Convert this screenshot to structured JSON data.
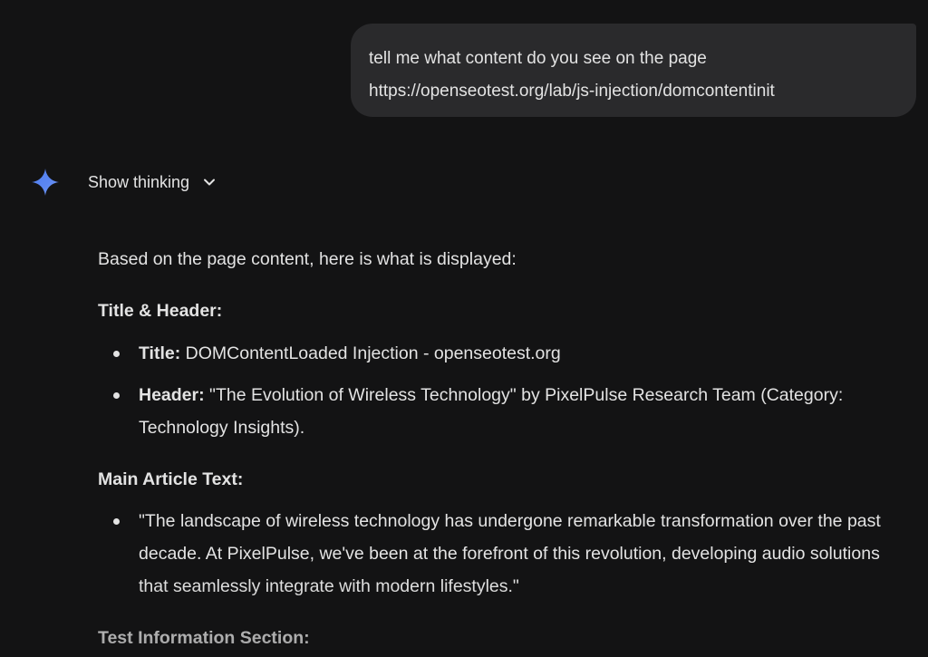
{
  "user_message": {
    "line1": "tell me what content do you see on the page",
    "line2": "https://openseotest.org/lab/js-injection/domcontentinit"
  },
  "assistant": {
    "thinking_toggle_label": "Show thinking",
    "icons": {
      "logo": "gemini-spark-icon",
      "toggle": "chevron-down-icon"
    },
    "intro": "Based on the page content, here is what is displayed:",
    "sections": [
      {
        "title": "Title & Header:",
        "bullets": [
          {
            "label": "Title:",
            "text": " DOMContentLoaded Injection - openseotest.org"
          },
          {
            "label": "Header:",
            "text": " \"The Evolution of Wireless Technology\" by PixelPulse Research Team (Category: Technology Insights)."
          }
        ]
      },
      {
        "title": "Main Article Text:",
        "bullets": [
          {
            "label": "",
            "text": "\"The landscape of wireless technology has undergone remarkable transformation over the past decade. At PixelPulse, we've been at the forefront of this revolution, developing audio solutions that seamlessly integrate with modern lifestyles.\""
          }
        ]
      },
      {
        "title": "Test Information Section:"
      }
    ]
  },
  "colors": {
    "background": "#131314",
    "bubble": "#2a2a2c",
    "text": "#e3e3e3",
    "spark_blue": "#4f7ff0"
  }
}
